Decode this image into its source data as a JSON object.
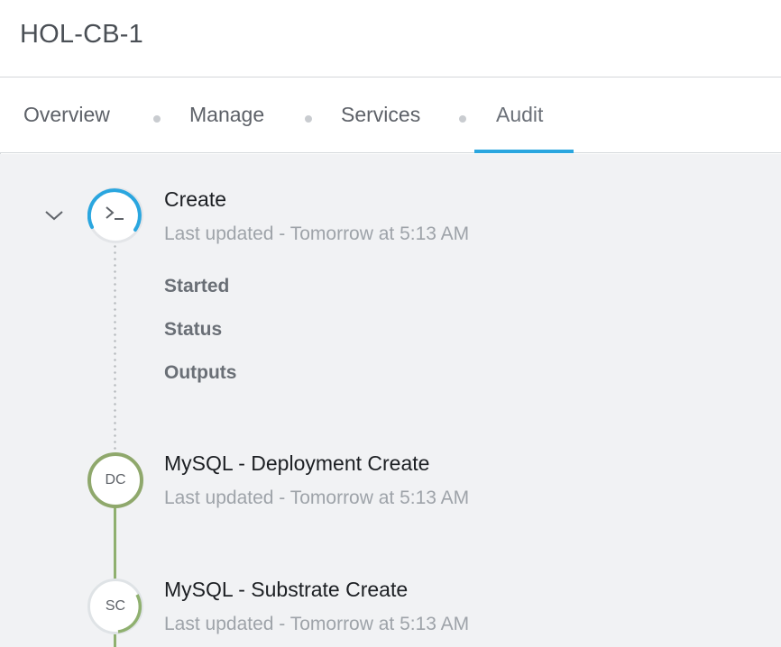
{
  "header": {
    "title": "HOL-CB-1"
  },
  "tabs": [
    {
      "label": "Overview"
    },
    {
      "label": "Manage"
    },
    {
      "label": "Services"
    },
    {
      "label": "Audit"
    }
  ],
  "active_tab": "Audit",
  "colors": {
    "accent": "#2aa6df",
    "success": "#8fa86c",
    "background": "#f1f2f4"
  },
  "audit": {
    "steps": [
      {
        "icon": "terminal-icon",
        "title": "Create",
        "subtitle": "Last updated - Tomorrow at 5:13 AM",
        "expanded": true,
        "details": [
          "Started",
          "Status",
          "Outputs"
        ]
      },
      {
        "badge": "DC",
        "title": "MySQL - Deployment Create",
        "subtitle": "Last updated - Tomorrow at 5:13 AM"
      },
      {
        "badge": "SC",
        "title": "MySQL - Substrate Create",
        "subtitle": "Last updated - Tomorrow at 5:13 AM"
      }
    ]
  }
}
